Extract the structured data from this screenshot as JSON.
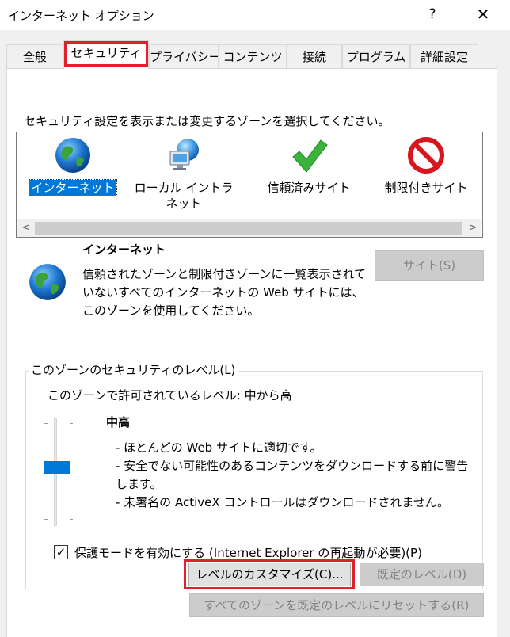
{
  "window": {
    "title": "インターネット オプション",
    "help_label": "?",
    "close_label": "✕"
  },
  "tabs": [
    {
      "label": "全般"
    },
    {
      "label": "セキュリティ",
      "active": true
    },
    {
      "label": "プライバシー"
    },
    {
      "label": "コンテンツ"
    },
    {
      "label": "接続"
    },
    {
      "label": "プログラム"
    },
    {
      "label": "詳細設定"
    }
  ],
  "highlight_color": "#e0202a",
  "security": {
    "zone_prompt": "セキュリティ設定を表示または変更するゾーンを選択してください。",
    "zones": [
      {
        "label": "インターネット",
        "icon": "globe-icon",
        "selected": true
      },
      {
        "label": "ローカル イントラネット",
        "icon": "intranet-icon"
      },
      {
        "label": "信頼済みサイト",
        "icon": "checkmark-icon"
      },
      {
        "label": "制限付きサイト",
        "icon": "prohibited-icon"
      }
    ],
    "scroll_left": "<",
    "scroll_right": ">",
    "selected_zone": {
      "title": "インターネット",
      "description": "信頼されたゾーンと制限付きゾーンに一覧表示されていないすべてのインターネットの Web サイトには、このゾーンを使用してください。",
      "sites_button": "サイト(S)"
    },
    "level_group": {
      "title": "このゾーンのセキュリティのレベル(L)",
      "allowed_text": "このゾーンで許可されているレベル: 中から高",
      "level_name": "中高",
      "level_position": 0.55,
      "level_lines": [
        "- ほとんどの Web サイトに適切です。",
        "- 安全でない可能性のあるコンテンツをダウンロードする前に警告します。",
        "- 未署名の ActiveX コントロールはダウンロードされません。"
      ],
      "protected_mode_label": "保護モードを有効にする (Internet Explorer の再起動が必要)(P)",
      "protected_mode_checked": true,
      "check_mark": "✓",
      "customize_button": "レベルのカスタマイズ(C)...",
      "default_button": "既定のレベル(D)"
    },
    "reset_all_button": "すべてのゾーンを既定のレベルにリセットする(R)"
  },
  "colors": {
    "selection": "#0078d7",
    "disabled_text": "#838383"
  }
}
